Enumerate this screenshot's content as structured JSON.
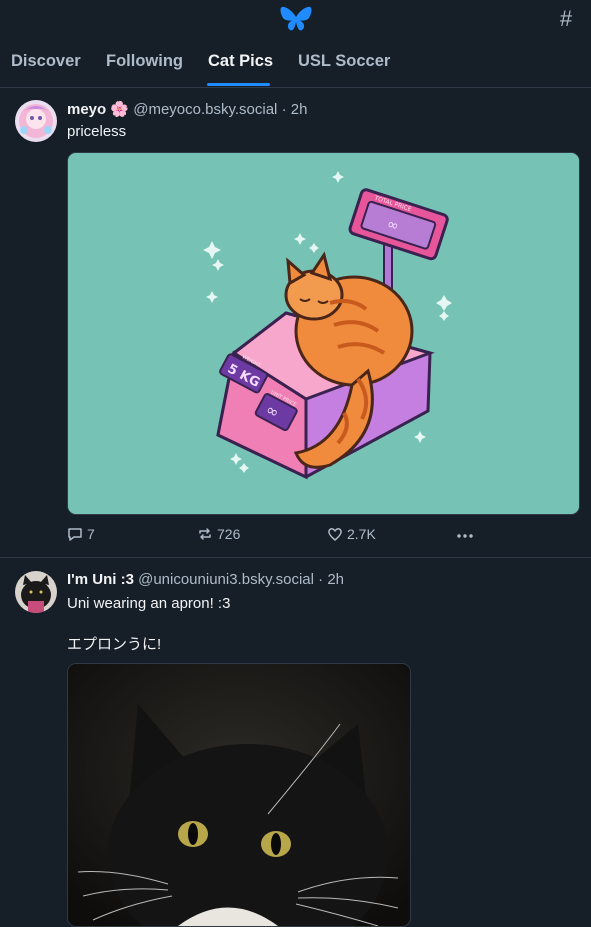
{
  "header": {
    "logo_icon": "butterfly-icon",
    "feeds_icon": "hashtag-icon",
    "feeds_glyph": "#"
  },
  "tabs": [
    {
      "label": "Discover",
      "active": false
    },
    {
      "label": "Following",
      "active": false
    },
    {
      "label": "Cat Pics",
      "active": true
    },
    {
      "label": "USL Soccer",
      "active": false
    }
  ],
  "posts": [
    {
      "author": "meyo",
      "author_emoji": "🌸",
      "handle": "@meyoco.bsky.social",
      "time": "· 2h",
      "text": "priceless",
      "image_labels": {
        "scale_top": "TOTAL PRICE",
        "weight": "WEIGHT",
        "weight_value": "5 KG",
        "unit_price": "UNIT PRICE"
      },
      "replies": "7",
      "reposts": "726",
      "likes": "2.7K"
    },
    {
      "author": "I'm Uni :3",
      "handle": "@unicouniuni3.bsky.social",
      "time": "· 2h",
      "text_line1": "Uni wearing an apron! :3",
      "text_line2": "エプロンうに!"
    }
  ],
  "colors": {
    "accent": "#208bfe",
    "background": "#161e27",
    "border": "#2e3a48",
    "secondary_text": "#aebbc9",
    "image_bg": "#76c2b5"
  }
}
